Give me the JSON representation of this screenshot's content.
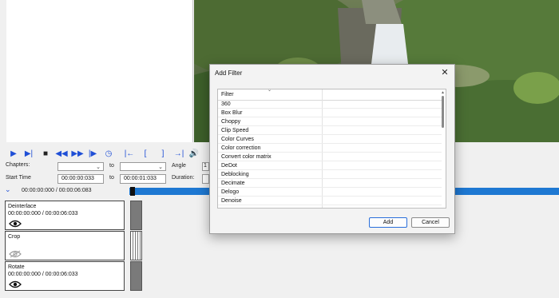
{
  "player": {
    "chapters_label": "Chapters:",
    "to_label_1": "to",
    "angle_label": "Angle",
    "angle_value": "1",
    "start_time_label": "Start Time",
    "start_time_value": "00:00:00:033",
    "to_label_2": "to",
    "end_time_value": "00:00:01:033",
    "duration_label": "Duration:",
    "position_readout": "00:00:00:000 / 00:00:06:083"
  },
  "filters": [
    {
      "name": "Deinterlace",
      "time": "00:00:00:000 / 00:00:06:033",
      "visible": true
    },
    {
      "name": "Crop",
      "time": "",
      "visible": false
    },
    {
      "name": "Rotate",
      "time": "00:00:00:000 / 00:00:06:033",
      "visible": true
    }
  ],
  "dialog": {
    "title": "Add Filter",
    "close_glyph": "✕",
    "column_header": "Filter",
    "items": [
      "360",
      "Box Blur",
      "Choppy",
      "Clip Speed",
      "Color Curves",
      "Color correction",
      "Convert color matrix",
      "DeDot",
      "Deblocking",
      "Decimate",
      "Delogo",
      "Denoise"
    ],
    "add_label": "Add",
    "cancel_label": "Cancel"
  },
  "colors": {
    "accent": "#1e78d2",
    "icon_blue": "#1f4fd6"
  },
  "icons": [
    "play-icon",
    "play-selection-icon",
    "stop-icon",
    "rewind-icon",
    "fast-forward-icon",
    "next-frame-icon",
    "clock-icon",
    "mark-in-icon",
    "mark-in-bracket-icon",
    "mark-out-bracket-icon",
    "mark-out-icon",
    "volume-icon",
    "expand-chevron-icon",
    "eye-icon",
    "eye-hidden-icon",
    "close-icon",
    "sort-arrow-icon"
  ]
}
